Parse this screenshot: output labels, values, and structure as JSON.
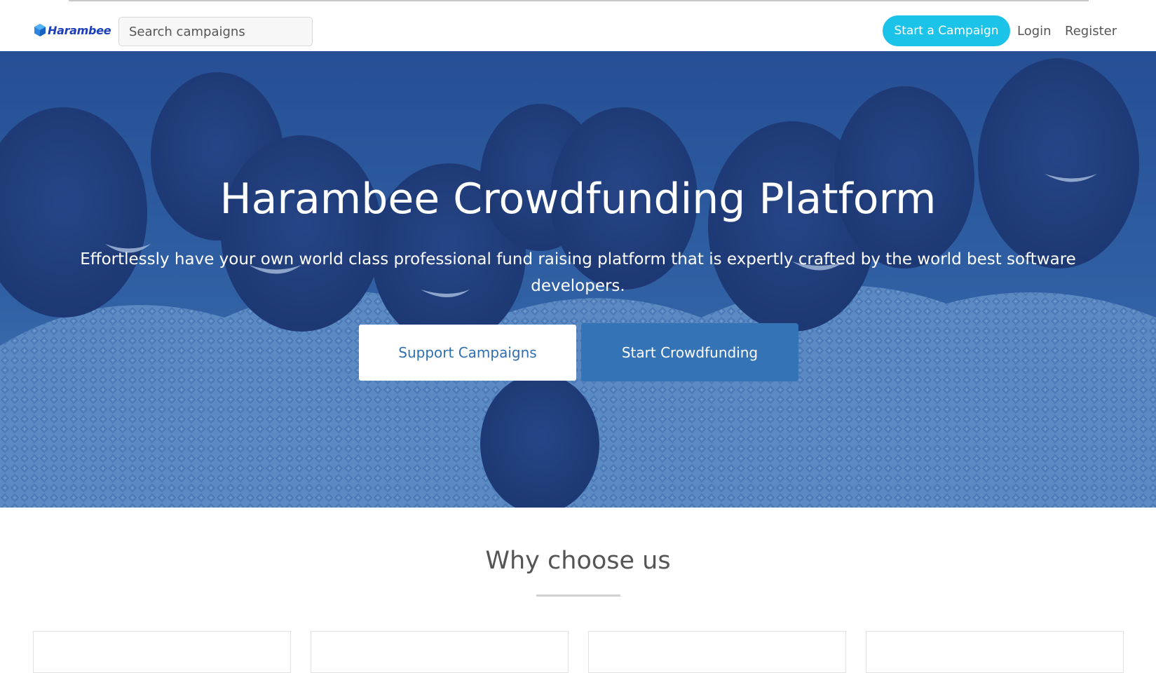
{
  "brand": {
    "name": "Harambee"
  },
  "header": {
    "search_placeholder": "Search campaigns",
    "start_campaign_label": "Start a Campaign",
    "login_label": "Login",
    "register_label": "Register"
  },
  "hero": {
    "title": "Harambee Crowdfunding Platform",
    "subtitle": "Effortlessly have your own world class professional fund raising platform that is expertly crafted by the world best software developers.",
    "support_button": "Support Campaigns",
    "start_button": "Start Crowdfunding"
  },
  "features": {
    "heading": "Why choose us",
    "cards": [
      {},
      {},
      {},
      {}
    ]
  },
  "colors": {
    "accent": "#1cc3e8",
    "primary": "#3473b6",
    "brand": "#1d3fb8",
    "hero_tint": "#3f72a6"
  }
}
